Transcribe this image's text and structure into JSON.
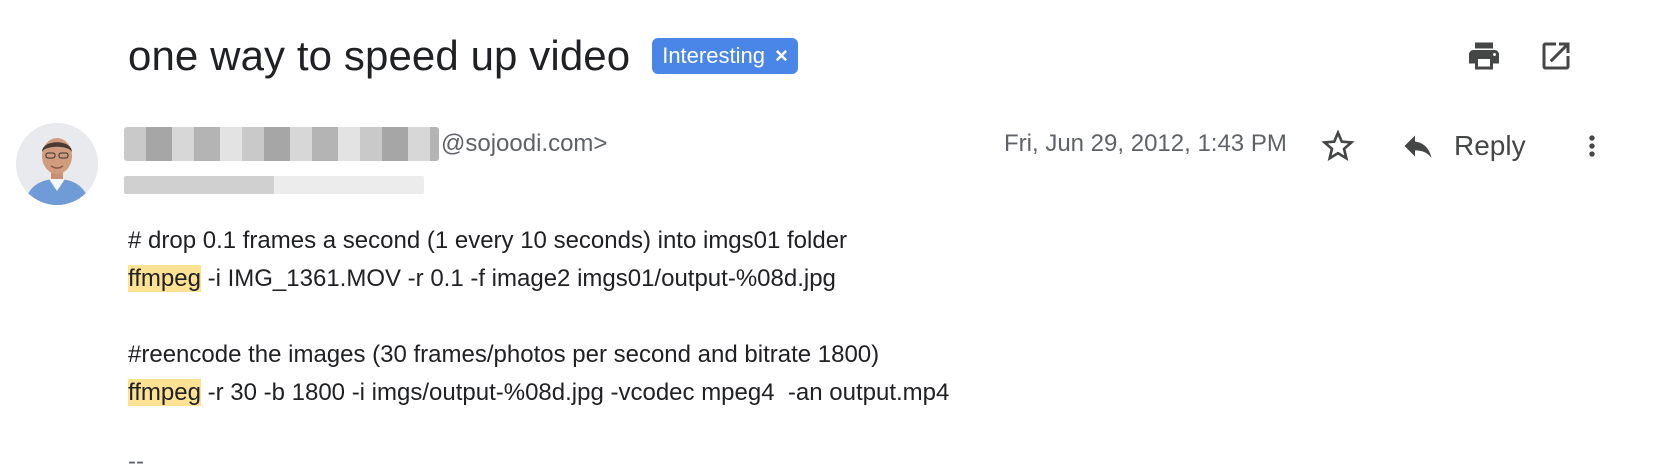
{
  "email": {
    "subject": "one way to speed up video",
    "label": {
      "text": "Interesting",
      "remove_glyph": "×",
      "color": "#4a86e8"
    },
    "sender_email_suffix": "@sojoodi.com>",
    "date": "Fri, Jun 29, 2012, 1:43 PM",
    "reply_label": "Reply",
    "body": {
      "line1": "# drop 0.1 frames a second (1 every 10 seconds) into imgs01 folder",
      "line2": {
        "highlight": "ffmpeg",
        "rest": " -i IMG_1361.MOV -r 0.1 -f image2 imgs01/output-%08d.jpg"
      },
      "line3": "#reencode the images (30 frames/photos per second and bitrate 1800)",
      "line4": {
        "highlight": "ffmpeg",
        "rest": " -r 30 -b 1800 -i imgs/output-%08d.jpg -vcodec mpeg4  -an output.mp4"
      }
    },
    "signature_start": "--"
  },
  "icons": {
    "print": "print-icon",
    "open_new_window": "open-in-new-window-icon",
    "star": "star-icon",
    "reply": "reply-icon",
    "more": "more-vertical-icon"
  },
  "colors": {
    "highlight": "#fde293",
    "muted_text": "#5f6368"
  }
}
